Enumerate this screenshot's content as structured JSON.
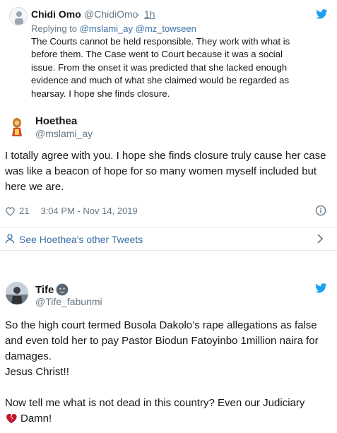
{
  "colors": {
    "link": "#3b6fa6",
    "muted": "#657786",
    "twitter_blue": "#1da1f2",
    "divider": "#e1e8ed",
    "heart_red": "#c0182b"
  },
  "reply_tweet": {
    "author_name": "Chidi Omo",
    "author_handle": "@ChidiOmo",
    "separator": "·",
    "time": "1h",
    "replying_to_label": "Replying to",
    "mention_1": "@mslami_ay",
    "mention_2": "@mz_towseen",
    "text": "The Courts cannot be held responsible. They work with what is before them. The Case went to Court because it was a social issue. From the onset it was predicted that she lacked enough evidence and much of what she claimed would be regarded as hearsay. I hope she finds closure.",
    "icon": "twitter-bird-icon"
  },
  "main_tweet": {
    "author_name": "Hoethea",
    "author_handle": "@mslami_ay",
    "text": "I totally agree with you. I hope she finds closure truly cause her case was like a beacon of hope for so many women myself included but here we are.",
    "likes": "21",
    "timestamp": "3:04 PM - Nov 14, 2019",
    "like_icon": "heart-outline-icon",
    "info_icon": "info-icon"
  },
  "other_tweets_link": {
    "label": "See Hoethea's other Tweets",
    "icon": "person-icon",
    "chevron": "chevron-right-icon"
  },
  "second_tweet": {
    "author_name": "Tife",
    "name_emoji": "face-emoji",
    "author_handle": "@Tife_fabunmi",
    "paragraph_1": "So the high court termed Busola Dakolo’s rape allegations as false and even told her to pay Pastor Biodun Fatoyinbo 1million naira for damages.",
    "paragraph_2": "Jesus Christ!!",
    "paragraph_3": "Now tell me what is not dead in this country? Even our Judiciary",
    "paragraph_3_end": "Damn!",
    "emoji": "broken-heart-icon"
  }
}
